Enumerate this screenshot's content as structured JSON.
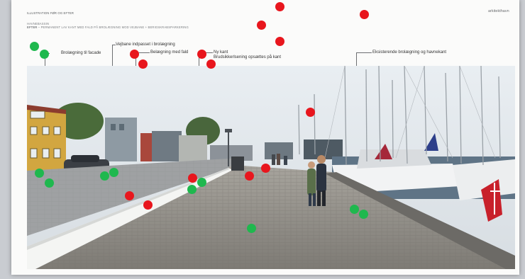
{
  "header": {
    "title": "ILLUSTRATION FØR OG EFTER",
    "section": "HAVNEBASSIN",
    "subtitle_prefix": "EFTER",
    "subtitle": " – PERMANENT LAV KANT MED FALD PÅ BROLÆGNING MOD VEJBANE + BERIGSKRABSPARKERING",
    "brand": "arkitekthavn"
  },
  "callouts": [
    {
      "id": "facade",
      "text": "Brolægning til facade"
    },
    {
      "id": "vejbane",
      "text": "Vejbane indpasset i brolægning"
    },
    {
      "id": "fald",
      "text": "Belægning med fald"
    },
    {
      "id": "kant",
      "text": "Ny kant"
    },
    {
      "id": "kant2",
      "text": "Brudsikkerlsening opsættes på kant"
    },
    {
      "id": "eksist",
      "text": "Eksisterende brolægning og havnekant"
    }
  ],
  "colors": {
    "red": "#e8161d",
    "green": "#1fb84e",
    "sky": "#dde3e8",
    "cobble": "#8f8d88"
  },
  "markers": {
    "red": 14,
    "green": 12
  }
}
